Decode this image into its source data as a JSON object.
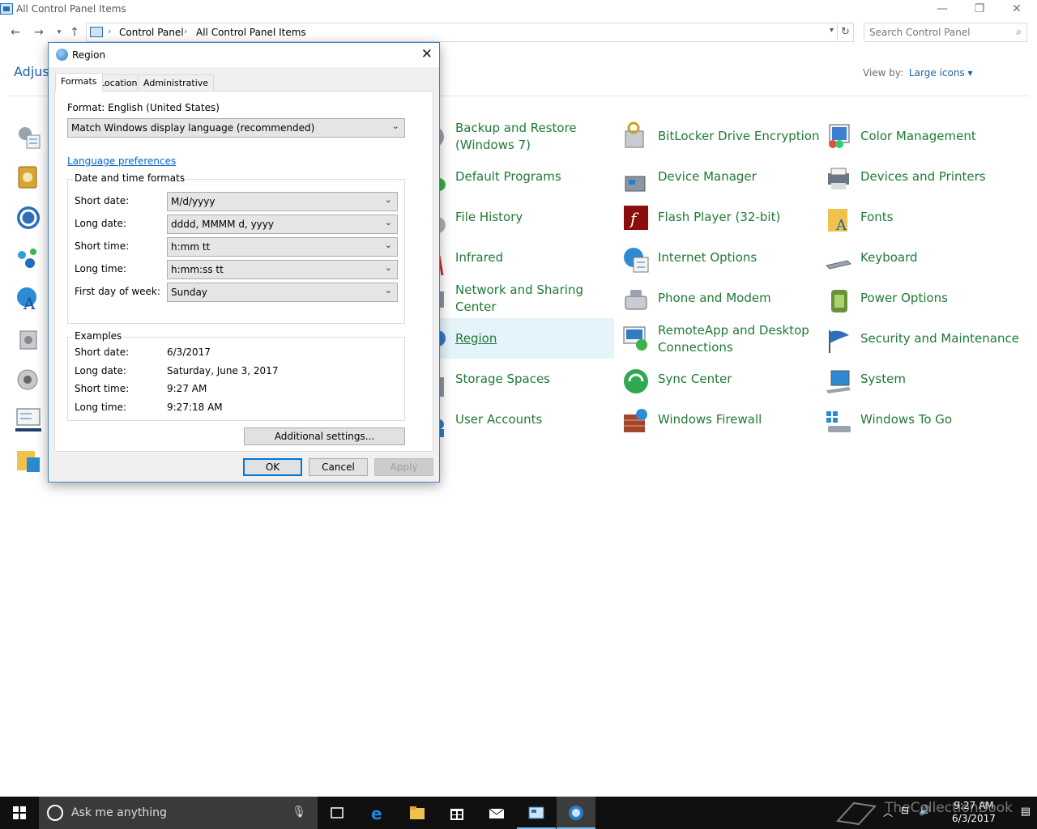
{
  "window": {
    "title": "All Control Panel Items",
    "minimize": "—",
    "restore": "❐",
    "close": "✕"
  },
  "address": {
    "crumbs": [
      "Control Panel",
      "All Control Panel Items"
    ],
    "search_placeholder": "Search Control Panel"
  },
  "main": {
    "heading": "Adjust",
    "view_by_label": "View by:",
    "view_by_value": "Large icons ▾",
    "items": [
      {
        "label": "Backup and Restore (Windows 7)"
      },
      {
        "label": "Default Programs"
      },
      {
        "label": "File History"
      },
      {
        "label": "Infrared"
      },
      {
        "label": "Network and Sharing Center"
      },
      {
        "label": "Region"
      },
      {
        "label": "Storage Spaces"
      },
      {
        "label": "User Accounts"
      },
      {
        "label": "BitLocker Drive Encryption"
      },
      {
        "label": "Device Manager"
      },
      {
        "label": "Flash Player (32-bit)"
      },
      {
        "label": "Internet Options"
      },
      {
        "label": "Phone and Modem"
      },
      {
        "label": "RemoteApp and Desktop Connections"
      },
      {
        "label": "Sync Center"
      },
      {
        "label": "Windows Firewall"
      },
      {
        "label": "Color Management"
      },
      {
        "label": "Devices and Printers"
      },
      {
        "label": "Fonts"
      },
      {
        "label": "Keyboard"
      },
      {
        "label": "Power Options"
      },
      {
        "label": "Security and Maintenance"
      },
      {
        "label": "System"
      },
      {
        "label": "Windows To Go"
      }
    ]
  },
  "dialog": {
    "title": "Region",
    "close": "✕",
    "tabs": [
      "Formats",
      "Location",
      "Administrative"
    ],
    "format_label": "Format: English (United States)",
    "format_value": "Match Windows display language (recommended)",
    "language_link": "Language preferences",
    "dt_group_title": "Date and time formats",
    "fields": [
      {
        "label": "Short date:",
        "value": "M/d/yyyy"
      },
      {
        "label": "Long date:",
        "value": "dddd, MMMM d, yyyy"
      },
      {
        "label": "Short time:",
        "value": "h:mm tt"
      },
      {
        "label": "Long time:",
        "value": "h:mm:ss tt"
      },
      {
        "label": "First day of week:",
        "value": "Sunday"
      }
    ],
    "examples_title": "Examples",
    "examples": [
      {
        "label": "Short date:",
        "value": "6/3/2017"
      },
      {
        "label": "Long date:",
        "value": "Saturday, June 3, 2017"
      },
      {
        "label": "Short time:",
        "value": "9:27 AM"
      },
      {
        "label": "Long time:",
        "value": "9:27:18 AM"
      }
    ],
    "additional_settings": "Additional settings...",
    "ok": "OK",
    "cancel": "Cancel",
    "apply": "Apply"
  },
  "taskbar": {
    "search_placeholder": "Ask me anything",
    "time": "9:27 AM",
    "date": "6/3/2017",
    "watermark": "TheCollectionBook"
  }
}
